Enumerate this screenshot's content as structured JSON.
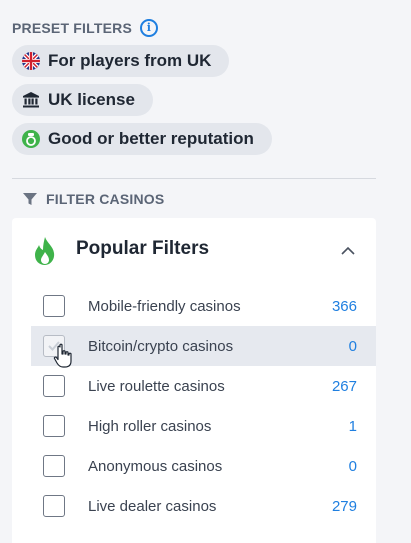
{
  "preset": {
    "title": "PRESET FILTERS",
    "info_icon": "info-icon",
    "chips": [
      {
        "label": "For players from UK",
        "icon": "uk-flag-icon"
      },
      {
        "label": "UK license",
        "icon": "bank-icon"
      },
      {
        "label": "Good or better reputation",
        "icon": "medal-icon"
      }
    ]
  },
  "filter": {
    "title": "FILTER CASINOS",
    "icon": "funnel-icon"
  },
  "panel": {
    "title": "Popular Filters",
    "icon": "flame-icon",
    "collapse_icon": "chevron-up-icon",
    "items": [
      {
        "label": "Mobile-friendly casinos",
        "count": "366",
        "checked": false
      },
      {
        "label": "Bitcoin/crypto casinos",
        "count": "0",
        "checked": false,
        "hovered": true
      },
      {
        "label": "Live roulette casinos",
        "count": "267",
        "checked": false
      },
      {
        "label": "High roller casinos",
        "count": "1",
        "checked": false
      },
      {
        "label": "Anonymous casinos",
        "count": "0",
        "checked": false
      },
      {
        "label": "Live dealer casinos",
        "count": "279",
        "checked": false
      }
    ]
  },
  "colors": {
    "accent": "#1f7fe0",
    "flame": "#3fb34a",
    "chip_bg": "#e3e6ec",
    "page_bg": "#f4f5f8"
  }
}
